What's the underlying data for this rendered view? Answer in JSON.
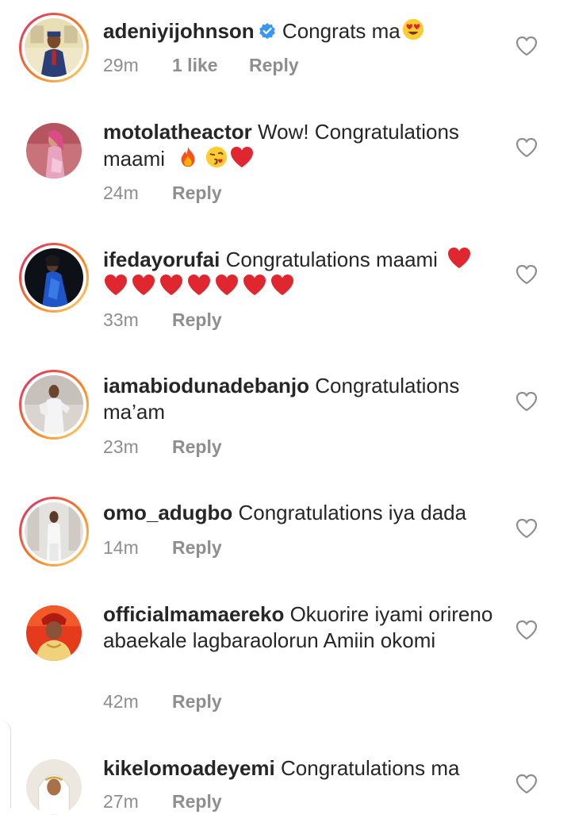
{
  "comments": [
    {
      "username": "adeniyijohnson",
      "verified": true,
      "text": "Congrats ma",
      "time": "29m",
      "likes": "1 like",
      "reply": "Reply",
      "emojis": [
        "heart-eyes"
      ]
    },
    {
      "username": "motolatheactor",
      "text": "Wow! Congratulations maami",
      "time": "24m",
      "reply": "Reply",
      "emojis": [
        "fire",
        "kiss",
        "red-heart"
      ]
    },
    {
      "username": "ifedayorufai",
      "text": "Congratulations maami",
      "time": "33m",
      "reply": "Reply",
      "emojis": [
        "red-heart",
        "red-heart",
        "red-heart",
        "red-heart",
        "red-heart",
        "red-heart",
        "red-heart",
        "red-heart"
      ]
    },
    {
      "username": "iamabiodunadebanjo",
      "text": "Congratulations ma’am",
      "time": "23m",
      "reply": "Reply"
    },
    {
      "username": "omo_adugbo",
      "text": "Congratulations iya dada",
      "time": "14m",
      "reply": "Reply"
    },
    {
      "username": "officialmamaereko",
      "text": "Okuorire iyami orireno abaekale lagbaraolorun Amiin okomi",
      "time": "42m",
      "reply": "Reply"
    },
    {
      "username": "kikelomoadeyemi",
      "text": "Congratulations ma",
      "time": "27m",
      "reply": "Reply"
    }
  ],
  "colors": {
    "text": "#262626",
    "meta": "#8e8e8e",
    "verified": "#3897f0",
    "heart": "#e0262f"
  }
}
